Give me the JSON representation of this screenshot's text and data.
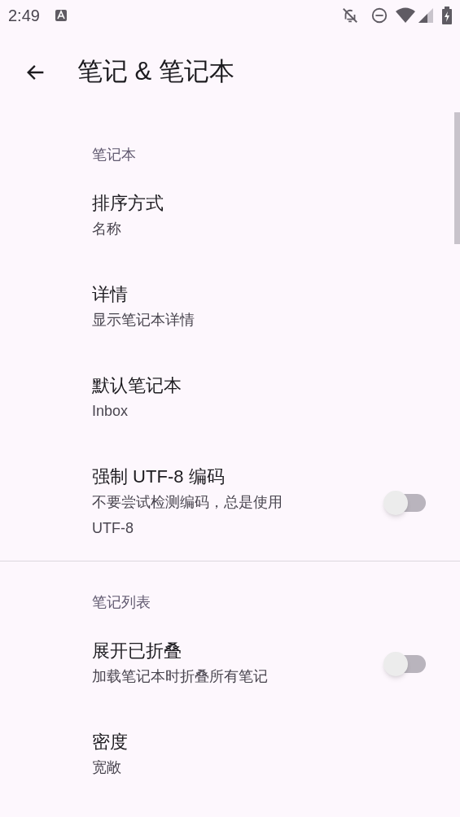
{
  "status_bar": {
    "time": "2:49"
  },
  "app_bar": {
    "title": "笔记 & 笔记本"
  },
  "sections": [
    {
      "header": "笔记本",
      "items": [
        {
          "kind": "pref",
          "title": "排序方式",
          "summary": "名称"
        },
        {
          "kind": "pref",
          "title": "详情",
          "summary": "显示笔记本详情"
        },
        {
          "kind": "pref",
          "title": "默认笔记本",
          "summary": "Inbox"
        },
        {
          "kind": "switch",
          "title": "强制 UTF-8 编码",
          "summary": "不要尝试检测编码，总是使用 UTF-8",
          "on": false
        }
      ]
    },
    {
      "header": "笔记列表",
      "items": [
        {
          "kind": "switch",
          "title": "展开已折叠",
          "summary": "加载笔记本时折叠所有笔记",
          "on": false
        },
        {
          "kind": "pref",
          "title": "密度",
          "summary": "宽敞"
        }
      ]
    }
  ]
}
